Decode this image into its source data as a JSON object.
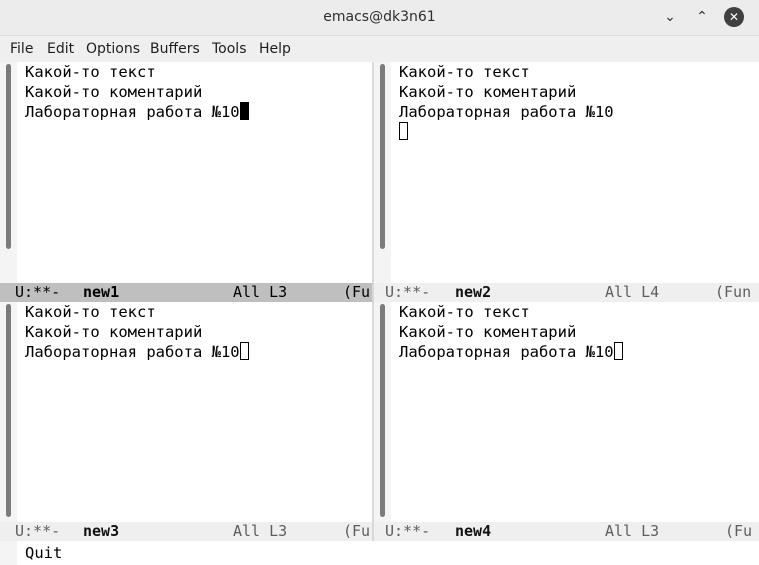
{
  "window": {
    "title": "emacs@dk3n61",
    "minimize_symbol": "⌄",
    "maximize_symbol": "⌃",
    "close_symbol": "✕"
  },
  "menu": [
    "File",
    "Edit",
    "Options",
    "Buffers",
    "Tools",
    "Help"
  ],
  "panes": [
    {
      "lines": [
        "Какой-то текст",
        "Какой-то коментарий",
        "Лабораторная работа №10"
      ],
      "cursor_line": 3,
      "cursor_style": "filled",
      "modeline": {
        "status": "U:**-",
        "buffer": "new1",
        "position": "All L3",
        "mode": "(Fu",
        "active": true
      }
    },
    {
      "lines": [
        "Какой-то текст",
        "Какой-то коментарий",
        "Лабораторная работа №10",
        ""
      ],
      "cursor_line": 4,
      "cursor_style": "hollow",
      "modeline": {
        "status": "U:**-",
        "buffer": "new2",
        "position": "All L4",
        "mode": "(Fun",
        "active": false
      }
    },
    {
      "lines": [
        "Какой-то текст",
        "Какой-то коментарий",
        "Лабораторная работа №10"
      ],
      "cursor_line": 3,
      "cursor_style": "hollow",
      "modeline": {
        "status": "U:**-",
        "buffer": "new3",
        "position": "All L3",
        "mode": "(Fu",
        "active": false
      }
    },
    {
      "lines": [
        "Какой-то текст",
        "Какой-то коментарий",
        "Лабораторная работа №10"
      ],
      "cursor_line": 3,
      "cursor_style": "hollow",
      "modeline": {
        "status": "U:**-",
        "buffer": "new4",
        "position": "All L3",
        "mode": "(Fu",
        "active": false
      }
    }
  ],
  "minibuffer": {
    "text": "Quit"
  },
  "colors": {
    "active_modeline": "#bfbfbf",
    "inactive_modeline": "#efefef",
    "titlebar": "#ececec"
  }
}
